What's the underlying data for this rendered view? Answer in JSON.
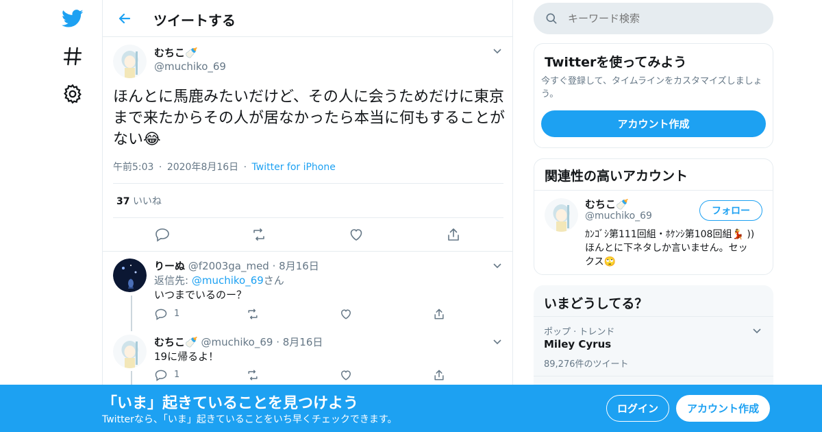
{
  "colors": {
    "accent": "#1da1f2",
    "muted": "#657786",
    "border": "#e6ecf0",
    "text": "#14171a"
  },
  "nav": {
    "icons": [
      "twitter-logo-icon",
      "hashtag-icon",
      "gear-icon"
    ]
  },
  "header": {
    "title": "ツイートする"
  },
  "main_tweet": {
    "name": "むちこ🍼",
    "handle": "@muchiko_69",
    "text": "ほんとに馬鹿みたいだけど、その人に会うためだけに東京まで来たからその人が居なかったら本当に何もすることがない😂",
    "time": "午前5:03",
    "date": "2020年8月16日",
    "source": "Twitter for iPhone",
    "likes_count": "37",
    "likes_label": "いいね"
  },
  "replies": [
    {
      "name": "りーぬ",
      "handle": "@f2003ga_med",
      "date": "8月16日",
      "reply_prefix": "返信先: ",
      "reply_to": "@muchiko_69",
      "reply_suffix": "さん",
      "text": "いつまでいるのー？",
      "reply_count": "1"
    },
    {
      "name": "むちこ🍼",
      "handle": "@muchiko_69",
      "date": "8月16日",
      "text": "19に帰るよ！",
      "reply_count": "1"
    }
  ],
  "search": {
    "placeholder": "キーワード検索"
  },
  "signup_card": {
    "title": "Twitterを使ってみよう",
    "description": "今すぐ登録して、タイムラインをカスタマイズしましょう。",
    "button": "アカウント作成"
  },
  "related_card": {
    "title": "関連性の高いアカウント",
    "name": "むちこ🍼",
    "handle": "@muchiko_69",
    "follow_button": "フォロー",
    "bio_line1": "ｶﾝｺﾞｼ第111回組・ﾎｹﾝｼ第108回組💃 ))",
    "bio_line2": "ほんとに下ネタしか言いません。セッ",
    "bio_line3": "クス🙄"
  },
  "trends_card": {
    "title": "いまどうしてる？",
    "items": [
      {
        "context": "ポップ · トレンド",
        "name": "Miley Cyrus",
        "count": "89,276件のツイート"
      }
    ]
  },
  "bottom_bar": {
    "headline": "「いま」起きていることを見つけよう",
    "subtext": "Twitterなら、「いま」起きていることをいち早くチェックできます。",
    "login_button": "ログイン",
    "signup_button": "アカウント作成"
  }
}
